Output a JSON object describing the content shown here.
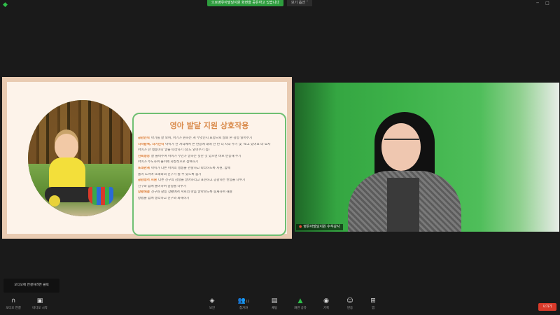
{
  "top_bar": {
    "share_banner": "으로영유아발달지원 화면을 공유하고 있습니다",
    "view_label": "보기 옵션 ˅"
  },
  "slide": {
    "title": "영아 발달 지원 상호작용",
    "items": [
      {
        "term": "공감인식",
        "text": "아기를 잘 보며, 아기가 원하는 게 무엇인지 표정으로 살펴 본 감정 읽어주기"
      },
      {
        "term": "시작탐색, 자기인식",
        "text": "아이가 한 자극에서 본 반응에 대해 한 번 더 자극 주기 및 ‘보고 있어요’라 묘사"
      },
      {
        "term": "",
        "text": "아이가 한 행동이나 말을 따라하기 (의도 읽어주기 등)"
      },
      {
        "term": "신뢰형성",
        "text": "잘 들어주며 아이가 무언가 말하는 듯한 것 있으면 바로 반응해 주기"
      },
      {
        "term": "",
        "text": "아이가 주도하며 놀이에 자발적으로 참여하기"
      },
      {
        "term": "또래관계",
        "text": "아이가 다른 아이의 행동을 관찰하고 따라하도록 지원, 함께"
      },
      {
        "term": "",
        "text": "놀이 느끼며 또래와의 친구가 될 수 있도록 돕기"
      },
      {
        "term": "공감정서 지원",
        "text": "다른 친구의 감정을 알아차리고 표현하고 공감하는 반응을 나누기"
      },
      {
        "term": "",
        "text": "친구와 함께 놀이하며 감정을 나누기"
      },
      {
        "term": "상황해결",
        "text": "친구와 갈등 상황에서 서로의 마음 알아보도록 중재하며 해결"
      },
      {
        "term": "",
        "text": "방법을 함께 생각하고 친구와 화해하기"
      }
    ]
  },
  "video": {
    "name_label": "영유아발달지원 수석강사"
  },
  "toast": {
    "text": "오디오에 연결하려면 클릭"
  },
  "toolbar": {
    "buttons": [
      {
        "icon": "headphone-icon",
        "label": "오디오 연결"
      },
      {
        "icon": "video-icon",
        "label": "비디오 시작"
      },
      {
        "icon": "shield-icon",
        "label": "보안"
      },
      {
        "icon": "participants-icon",
        "label": "참가자",
        "count": "12"
      },
      {
        "icon": "chat-icon",
        "label": "채팅"
      },
      {
        "icon": "share-icon",
        "label": "화면 공유"
      },
      {
        "icon": "record-icon",
        "label": "기록"
      },
      {
        "icon": "reaction-icon",
        "label": "반응"
      },
      {
        "icon": "apps-icon",
        "label": "앱"
      }
    ],
    "end_label": "나가기"
  }
}
